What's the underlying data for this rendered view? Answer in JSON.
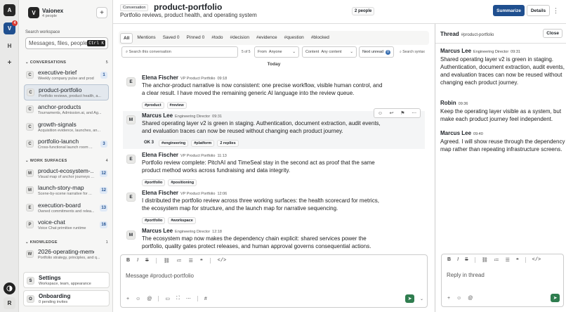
{
  "rail": {
    "items": [
      {
        "label": "A"
      },
      {
        "label": "V",
        "badge": "4"
      },
      {
        "label": "H"
      },
      {
        "label": "+"
      }
    ],
    "bottom": [
      {
        "label": "R"
      }
    ]
  },
  "workspace": {
    "logo": "V",
    "name": "Vaionex",
    "people": "4 people",
    "search_label": "Search workspace",
    "search_placeholder": "Messages, files, people",
    "search_kbd": "Ctrl K"
  },
  "sections": {
    "conversations": {
      "label": "CONVERSATIONS",
      "count": "5"
    },
    "work_surfaces": {
      "label": "WORK SURFACES",
      "count": "4"
    },
    "knowledge": {
      "label": "KNOWLEDGE",
      "count": "1"
    }
  },
  "conversations": [
    {
      "avatar": "C",
      "name": "executive-brief",
      "desc": "Weekly company pulse and prod...",
      "count": "1"
    },
    {
      "avatar": "C",
      "name": "product-portfolio",
      "desc": "Portfolio reviews, product health, a...",
      "count": ""
    },
    {
      "avatar": "C",
      "name": "anchor-products",
      "desc": "Tournaments, Admission.ai, and Ag...",
      "count": ""
    },
    {
      "avatar": "C",
      "name": "growth-signals",
      "desc": "Acquisition evidence, launches, an...",
      "count": ""
    },
    {
      "avatar": "C",
      "name": "portfolio-launch",
      "desc": "Cross-functional launch room ...",
      "count": "3"
    }
  ],
  "work_surfaces": [
    {
      "avatar": "M",
      "name": "product-ecosystem-...",
      "desc": "Visual map of anchor journeys ...",
      "count": "12"
    },
    {
      "avatar": "M",
      "name": "launch-story-map",
      "desc": "Scene-by-scene narrative for ...",
      "count": "12"
    },
    {
      "avatar": "E",
      "name": "execution-board",
      "desc": "Owned commitments and relea...",
      "count": "13"
    },
    {
      "avatar": "P",
      "name": "voice-chat",
      "desc": "Voice Chat primitive runtime",
      "count": "16"
    }
  ],
  "knowledge": [
    {
      "avatar": "W",
      "name": "2026-operating-memo",
      "desc": "Portfolio strategy, principles, and q...",
      "count": ""
    }
  ],
  "footer": {
    "settings": {
      "avatar": "S",
      "title": "Settings",
      "sub": "Workspace, team, appearance"
    },
    "onboarding": {
      "avatar": "O",
      "title": "Onboarding",
      "sub": "0 pending invites"
    }
  },
  "header": {
    "tag": "Conversation",
    "title": "product-portfolio",
    "subtitle": "Portfolio reviews, product health, and operating system",
    "people": "2 people",
    "summarize": "Summarize",
    "details": "Details",
    "more": "⋮"
  },
  "tabs": [
    "All",
    "Mentions",
    "Saved 0",
    "Pinned 0",
    "#todo",
    "#decision",
    "#evidence",
    "#question",
    "#blocked"
  ],
  "filters": {
    "search_placeholder": "Search this conversation",
    "count": "5 of 5",
    "from_label": "From",
    "from_value": "Anyone",
    "content_label": "Content",
    "content_value": "Any content",
    "next_unread": "Next unread",
    "next_unread_count": "0",
    "syntax": "Search syntax"
  },
  "day_divider": "Today",
  "messages": [
    {
      "avatar": "E",
      "author": "Elena Fischer",
      "role": "VP Product Portfolio",
      "time": "09:18",
      "body": "The anchor-product narrative is now consistent: one precise workflow, visible human control, and a clear result. I have moved the remaining generic AI language into the review queue.",
      "tags": [
        "#product",
        "#review"
      ]
    },
    {
      "avatar": "M",
      "author": "Marcus Lee",
      "role": "Engineering Director",
      "time": "09:31",
      "body": "Shared operating layer v2 is green in staging. Authentication, document extraction, audit events, and evaluation traces can now be reused without changing each product journey.",
      "tags": [
        "OK  3",
        "#engineering",
        "#platform",
        "2 replies"
      ]
    },
    {
      "avatar": "E",
      "author": "Elena Fischer",
      "role": "VP Product Portfolio",
      "time": "11:13",
      "body": "Portfolio review complete: PitchAI and TimeSeal stay in the second act as proof that the same product method works across fundraising and data integrity.",
      "tags": [
        "#portfolio",
        "#positioning"
      ]
    },
    {
      "avatar": "E",
      "author": "Elena Fischer",
      "role": "VP Product Portfolio",
      "time": "12:06",
      "body": "I distributed the portfolio review across three working surfaces: the health scorecard for metrics, the ecosystem map for structure, and the launch map for narrative sequencing.",
      "tags": [
        "#portfolio",
        "#workspace"
      ]
    },
    {
      "avatar": "M",
      "author": "Marcus Lee",
      "role": "Engineering Director",
      "time": "12:18",
      "body": "The ecosystem map now makes the dependency chain explicit: shared services power the portfolio, quality gates protect releases, and human approval governs consequential actions.",
      "tags": []
    }
  ],
  "composer": {
    "placeholder": "Message #product-portfolio"
  },
  "thread": {
    "title": "Thread",
    "channel": "#product-portfolio",
    "close": "Close",
    "messages": [
      {
        "author": "Marcus Lee",
        "role": "Engineering Director",
        "time": "09:31",
        "body": "Shared operating layer v2 is green in staging. Authentication, document extraction, audit events, and evaluation traces can now be reused without changing each product journey."
      },
      {
        "author": "Robin",
        "role": "",
        "time": "09:36",
        "body": "Keep the operating layer visible as a system, but make each product journey feel independent."
      },
      {
        "author": "Marcus Lee",
        "role": "",
        "time": "09:40",
        "body": "Agreed. I will show reuse through the dependency map rather than repeating infrastructure screens."
      }
    ],
    "composer_placeholder": "Reply in thread"
  }
}
